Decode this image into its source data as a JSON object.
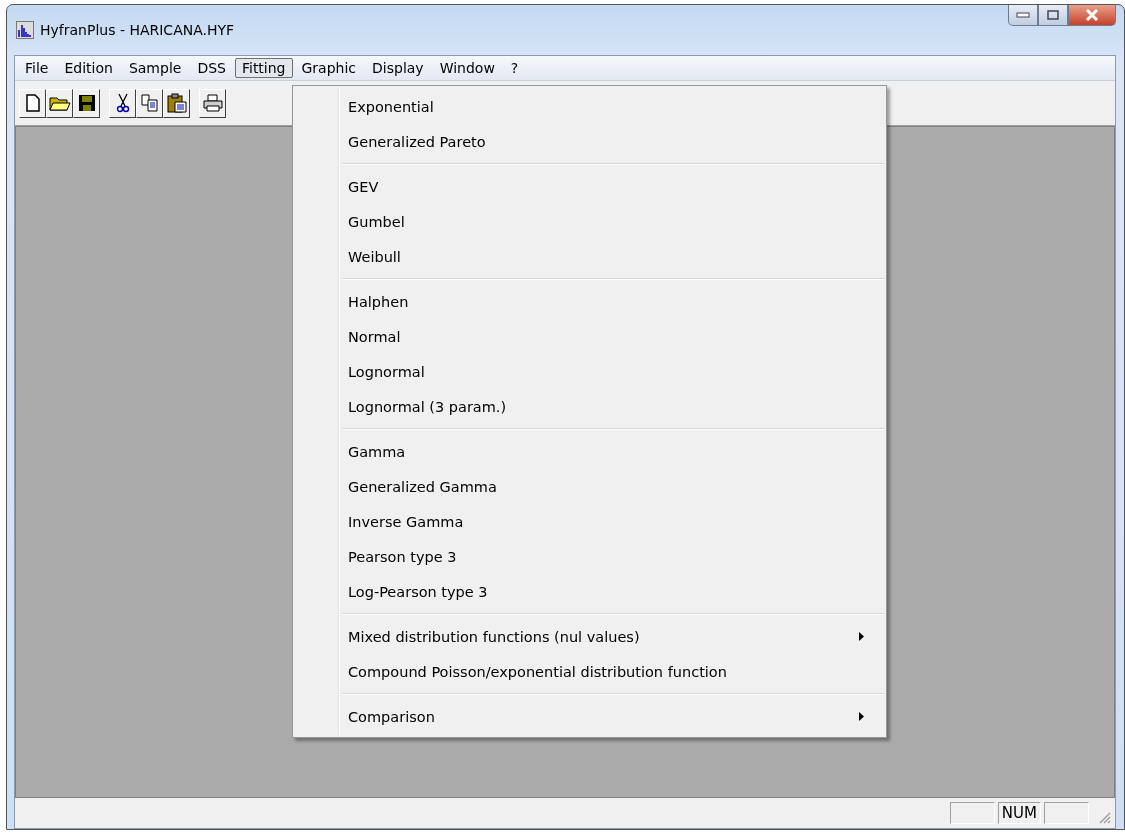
{
  "window": {
    "title": "HyfranPlus - HARICANA.HYF"
  },
  "menu_bar": [
    {
      "label": "File",
      "selected": false
    },
    {
      "label": "Edition",
      "selected": false
    },
    {
      "label": "Sample",
      "selected": false
    },
    {
      "label": "DSS",
      "selected": false
    },
    {
      "label": "Fitting",
      "selected": true
    },
    {
      "label": "Graphic",
      "selected": false
    },
    {
      "label": "Display",
      "selected": false
    },
    {
      "label": "Window",
      "selected": false
    },
    {
      "label": "?",
      "selected": false
    }
  ],
  "toolbar": [
    {
      "kind": "new"
    },
    {
      "kind": "open"
    },
    {
      "kind": "save"
    },
    {
      "kind": "gap"
    },
    {
      "kind": "cut"
    },
    {
      "kind": "copy"
    },
    {
      "kind": "paste"
    },
    {
      "kind": "gap"
    },
    {
      "kind": "print"
    }
  ],
  "fitting_menu": {
    "sections": [
      {
        "items": [
          {
            "label": "Exponential",
            "submenu": false
          },
          {
            "label": "Generalized Pareto",
            "submenu": false
          }
        ]
      },
      {
        "items": [
          {
            "label": "GEV",
            "submenu": false
          },
          {
            "label": "Gumbel",
            "submenu": false
          },
          {
            "label": "Weibull",
            "submenu": false
          }
        ]
      },
      {
        "items": [
          {
            "label": "Halphen",
            "submenu": false
          },
          {
            "label": "Normal",
            "submenu": false
          },
          {
            "label": "Lognormal",
            "submenu": false
          },
          {
            "label": "Lognormal (3 param.)",
            "submenu": false
          }
        ]
      },
      {
        "items": [
          {
            "label": "Gamma",
            "submenu": false
          },
          {
            "label": "Generalized Gamma",
            "submenu": false
          },
          {
            "label": "Inverse Gamma",
            "submenu": false
          },
          {
            "label": "Pearson type 3",
            "submenu": false
          },
          {
            "label": "Log-Pearson type 3",
            "submenu": false
          }
        ]
      },
      {
        "items": [
          {
            "label": "Mixed distribution functions (nul values)",
            "submenu": true
          },
          {
            "label": "Compound Poisson/exponential distribution function",
            "submenu": false
          }
        ]
      },
      {
        "items": [
          {
            "label": "Comparison",
            "submenu": true
          }
        ]
      }
    ]
  },
  "status_bar": {
    "indicator": "NUM"
  }
}
